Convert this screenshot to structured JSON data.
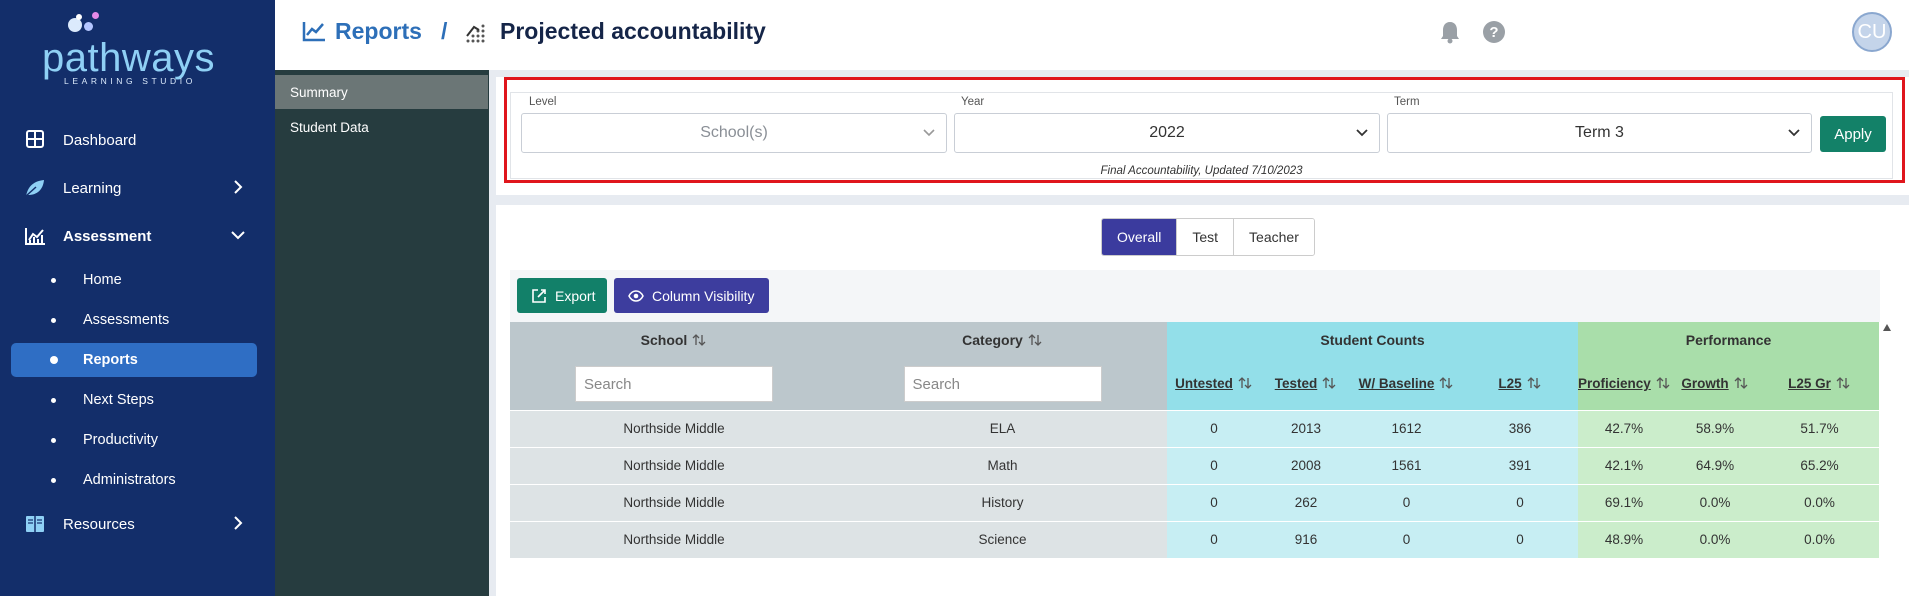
{
  "brand": {
    "name": "pathways",
    "tagline": "LEARNING STUDIO",
    "colors": {
      "sidebar": "#132e6a",
      "active": "#2f6ec4",
      "accent_teal": "#138168",
      "accent_indigo": "#3b3b9e"
    }
  },
  "sidebar": {
    "items": [
      {
        "label": "Dashboard",
        "icon": "grid-icon"
      },
      {
        "label": "Learning",
        "icon": "leaf-icon"
      },
      {
        "label": "Assessment",
        "icon": "chart-icon"
      },
      {
        "label": "Resources",
        "icon": "book-icon"
      }
    ],
    "assessment_sub": [
      {
        "label": "Home"
      },
      {
        "label": "Assessments"
      },
      {
        "label": "Reports",
        "active": true
      },
      {
        "label": "Next Steps"
      },
      {
        "label": "Productivity"
      },
      {
        "label": "Administrators"
      }
    ]
  },
  "header": {
    "breadcrumb_root": "Reports",
    "separator": "/",
    "page_title": "Projected accountability",
    "avatar_initials": "CU"
  },
  "subnav": [
    {
      "label": "Summary",
      "active": true
    },
    {
      "label": "Student Data"
    }
  ],
  "filters": {
    "level": {
      "label": "Level",
      "value": "School(s)"
    },
    "year": {
      "label": "Year",
      "value": "2022"
    },
    "term": {
      "label": "Term",
      "value": "Term 3"
    },
    "apply_label": "Apply",
    "updated_note": "Final Accountability, Updated 7/10/2023"
  },
  "view_tabs": [
    {
      "label": "Overall",
      "active": true
    },
    {
      "label": "Test"
    },
    {
      "label": "Teacher"
    }
  ],
  "toolbar": {
    "export_label": "Export",
    "column_visibility_label": "Column Visibility"
  },
  "table": {
    "groups": {
      "student_counts": "Student Counts",
      "performance": "Performance"
    },
    "columns": {
      "school": "School",
      "category": "Category",
      "untested": "Untested",
      "tested": "Tested",
      "baseline": "W/ Baseline",
      "l25": "L25",
      "proficiency": "Proficiency",
      "growth": "Growth",
      "l25_growth": "L25 Gr"
    },
    "search_placeholder": "Search",
    "rows": [
      {
        "school": "Northside Middle",
        "category": "ELA",
        "untested": "0",
        "tested": "2013",
        "baseline": "1612",
        "l25": "386",
        "proficiency": "42.7%",
        "growth": "58.9%",
        "l25_growth": "51.7%"
      },
      {
        "school": "Northside Middle",
        "category": "Math",
        "untested": "0",
        "tested": "2008",
        "baseline": "1561",
        "l25": "391",
        "proficiency": "42.1%",
        "growth": "64.9%",
        "l25_growth": "65.2%"
      },
      {
        "school": "Northside Middle",
        "category": "History",
        "untested": "0",
        "tested": "262",
        "baseline": "0",
        "l25": "0",
        "proficiency": "69.1%",
        "growth": "0.0%",
        "l25_growth": "0.0%"
      },
      {
        "school": "Northside Middle",
        "category": "Science",
        "untested": "0",
        "tested": "916",
        "baseline": "0",
        "l25": "0",
        "proficiency": "48.9%",
        "growth": "0.0%",
        "l25_growth": "0.0%"
      }
    ]
  }
}
